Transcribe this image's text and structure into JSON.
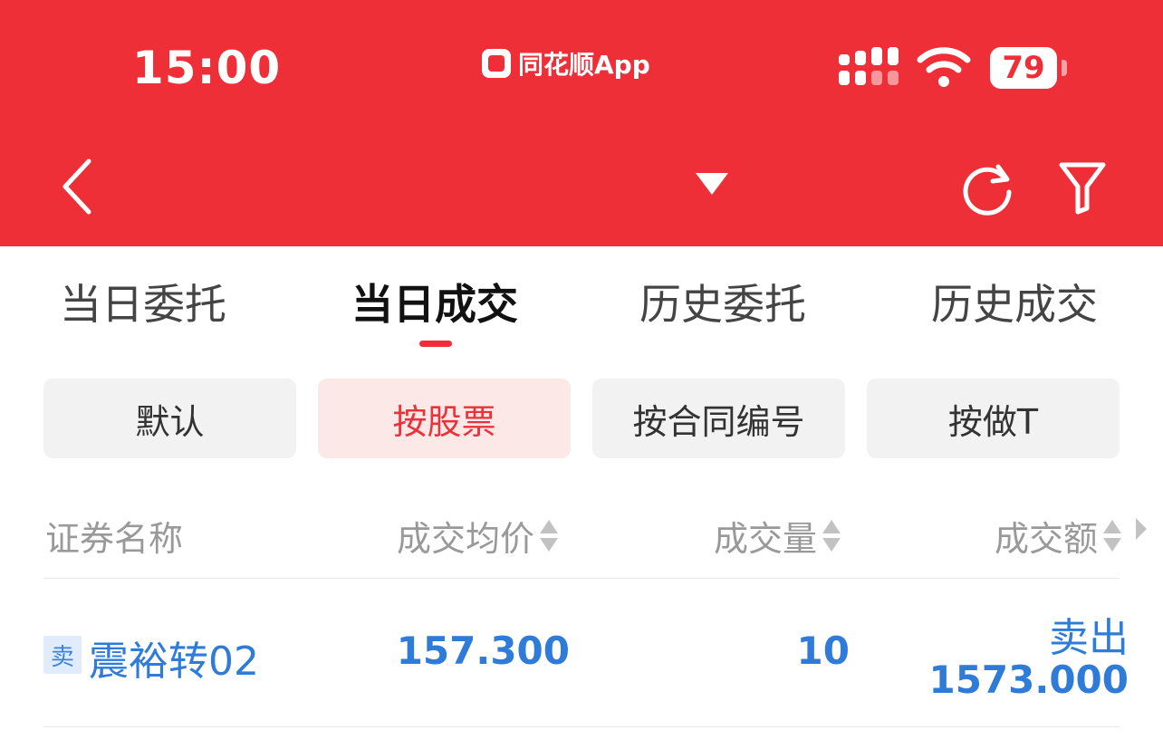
{
  "status_bar": {
    "time": "15:00",
    "app_name": "同花顺App",
    "battery": "79"
  },
  "nav": {
    "title": "",
    "icons": [
      "back-icon",
      "dropdown-icon",
      "refresh-icon",
      "filter-icon"
    ]
  },
  "tabs": [
    "当日委托",
    "当日成交",
    "历史委托",
    "历史成交"
  ],
  "active_tab": "当日成交",
  "chips": [
    "默认",
    "按股票",
    "按合同编号",
    "按做T"
  ],
  "active_chip": "按股票",
  "table": {
    "headers": [
      "证券名称",
      "成交均价",
      "成交量",
      "成交额"
    ],
    "rows": [
      {
        "side": "卖",
        "name": "震裕转02",
        "price": "157.300",
        "quantity": "10",
        "direction": "卖出",
        "amount": "1573.000"
      }
    ]
  },
  "colors": {
    "brand_red": "#ee2f37",
    "link_blue": "#2f7bd9",
    "chip_active_bg": "#fde8e8"
  }
}
